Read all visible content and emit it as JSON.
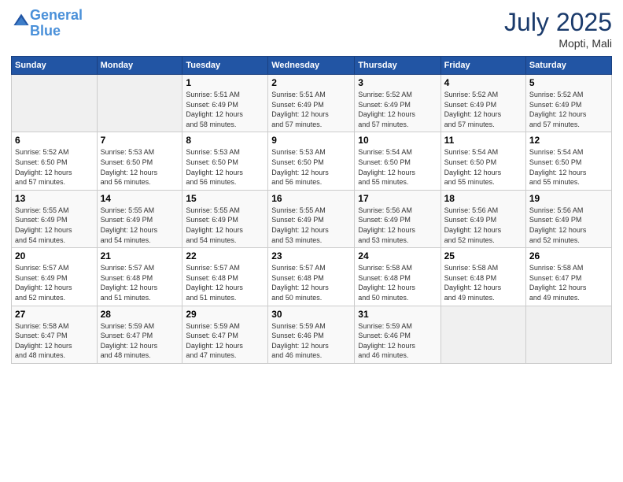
{
  "logo": {
    "line1": "General",
    "line2": "Blue"
  },
  "title": "July 2025",
  "location": "Mopti, Mali",
  "days_header": [
    "Sunday",
    "Monday",
    "Tuesday",
    "Wednesday",
    "Thursday",
    "Friday",
    "Saturday"
  ],
  "weeks": [
    [
      {
        "day": "",
        "info": ""
      },
      {
        "day": "",
        "info": ""
      },
      {
        "day": "1",
        "info": "Sunrise: 5:51 AM\nSunset: 6:49 PM\nDaylight: 12 hours\nand 58 minutes."
      },
      {
        "day": "2",
        "info": "Sunrise: 5:51 AM\nSunset: 6:49 PM\nDaylight: 12 hours\nand 57 minutes."
      },
      {
        "day": "3",
        "info": "Sunrise: 5:52 AM\nSunset: 6:49 PM\nDaylight: 12 hours\nand 57 minutes."
      },
      {
        "day": "4",
        "info": "Sunrise: 5:52 AM\nSunset: 6:49 PM\nDaylight: 12 hours\nand 57 minutes."
      },
      {
        "day": "5",
        "info": "Sunrise: 5:52 AM\nSunset: 6:49 PM\nDaylight: 12 hours\nand 57 minutes."
      }
    ],
    [
      {
        "day": "6",
        "info": "Sunrise: 5:52 AM\nSunset: 6:50 PM\nDaylight: 12 hours\nand 57 minutes."
      },
      {
        "day": "7",
        "info": "Sunrise: 5:53 AM\nSunset: 6:50 PM\nDaylight: 12 hours\nand 56 minutes."
      },
      {
        "day": "8",
        "info": "Sunrise: 5:53 AM\nSunset: 6:50 PM\nDaylight: 12 hours\nand 56 minutes."
      },
      {
        "day": "9",
        "info": "Sunrise: 5:53 AM\nSunset: 6:50 PM\nDaylight: 12 hours\nand 56 minutes."
      },
      {
        "day": "10",
        "info": "Sunrise: 5:54 AM\nSunset: 6:50 PM\nDaylight: 12 hours\nand 55 minutes."
      },
      {
        "day": "11",
        "info": "Sunrise: 5:54 AM\nSunset: 6:50 PM\nDaylight: 12 hours\nand 55 minutes."
      },
      {
        "day": "12",
        "info": "Sunrise: 5:54 AM\nSunset: 6:50 PM\nDaylight: 12 hours\nand 55 minutes."
      }
    ],
    [
      {
        "day": "13",
        "info": "Sunrise: 5:55 AM\nSunset: 6:49 PM\nDaylight: 12 hours\nand 54 minutes."
      },
      {
        "day": "14",
        "info": "Sunrise: 5:55 AM\nSunset: 6:49 PM\nDaylight: 12 hours\nand 54 minutes."
      },
      {
        "day": "15",
        "info": "Sunrise: 5:55 AM\nSunset: 6:49 PM\nDaylight: 12 hours\nand 54 minutes."
      },
      {
        "day": "16",
        "info": "Sunrise: 5:55 AM\nSunset: 6:49 PM\nDaylight: 12 hours\nand 53 minutes."
      },
      {
        "day": "17",
        "info": "Sunrise: 5:56 AM\nSunset: 6:49 PM\nDaylight: 12 hours\nand 53 minutes."
      },
      {
        "day": "18",
        "info": "Sunrise: 5:56 AM\nSunset: 6:49 PM\nDaylight: 12 hours\nand 52 minutes."
      },
      {
        "day": "19",
        "info": "Sunrise: 5:56 AM\nSunset: 6:49 PM\nDaylight: 12 hours\nand 52 minutes."
      }
    ],
    [
      {
        "day": "20",
        "info": "Sunrise: 5:57 AM\nSunset: 6:49 PM\nDaylight: 12 hours\nand 52 minutes."
      },
      {
        "day": "21",
        "info": "Sunrise: 5:57 AM\nSunset: 6:48 PM\nDaylight: 12 hours\nand 51 minutes."
      },
      {
        "day": "22",
        "info": "Sunrise: 5:57 AM\nSunset: 6:48 PM\nDaylight: 12 hours\nand 51 minutes."
      },
      {
        "day": "23",
        "info": "Sunrise: 5:57 AM\nSunset: 6:48 PM\nDaylight: 12 hours\nand 50 minutes."
      },
      {
        "day": "24",
        "info": "Sunrise: 5:58 AM\nSunset: 6:48 PM\nDaylight: 12 hours\nand 50 minutes."
      },
      {
        "day": "25",
        "info": "Sunrise: 5:58 AM\nSunset: 6:48 PM\nDaylight: 12 hours\nand 49 minutes."
      },
      {
        "day": "26",
        "info": "Sunrise: 5:58 AM\nSunset: 6:47 PM\nDaylight: 12 hours\nand 49 minutes."
      }
    ],
    [
      {
        "day": "27",
        "info": "Sunrise: 5:58 AM\nSunset: 6:47 PM\nDaylight: 12 hours\nand 48 minutes."
      },
      {
        "day": "28",
        "info": "Sunrise: 5:59 AM\nSunset: 6:47 PM\nDaylight: 12 hours\nand 48 minutes."
      },
      {
        "day": "29",
        "info": "Sunrise: 5:59 AM\nSunset: 6:47 PM\nDaylight: 12 hours\nand 47 minutes."
      },
      {
        "day": "30",
        "info": "Sunrise: 5:59 AM\nSunset: 6:46 PM\nDaylight: 12 hours\nand 46 minutes."
      },
      {
        "day": "31",
        "info": "Sunrise: 5:59 AM\nSunset: 6:46 PM\nDaylight: 12 hours\nand 46 minutes."
      },
      {
        "day": "",
        "info": ""
      },
      {
        "day": "",
        "info": ""
      }
    ]
  ]
}
